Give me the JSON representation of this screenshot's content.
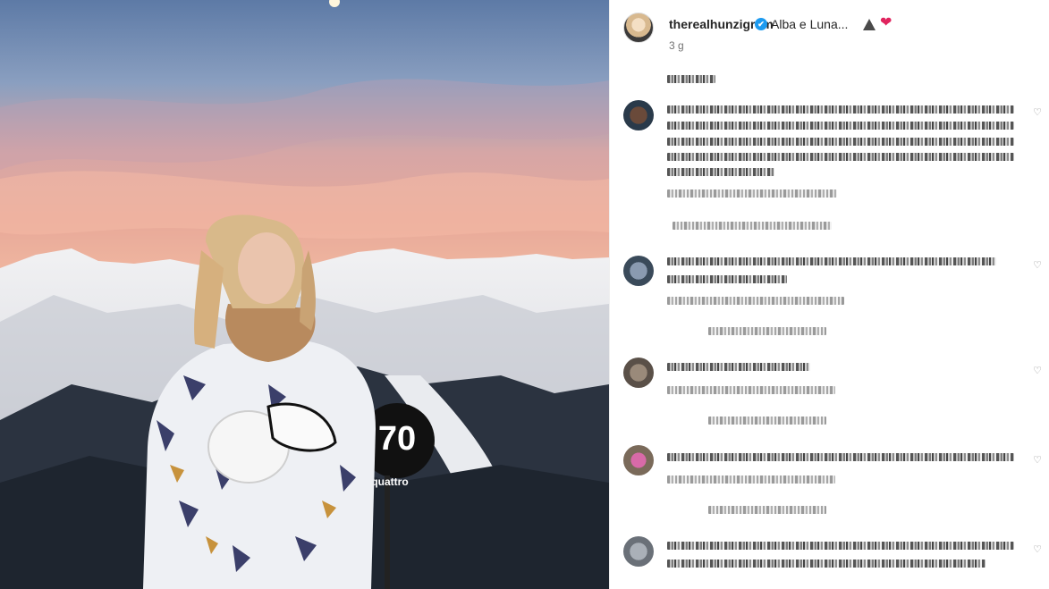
{
  "post": {
    "username": "therealhunzigram",
    "caption": "Alba e Luna...",
    "time_ago": "3 g",
    "verified_symbol": "✔",
    "heart_symbol": "❤"
  },
  "media": {
    "sign_text": "70",
    "sign_subtext": "quattro"
  },
  "icons": {
    "like": "heart-outline-icon"
  }
}
